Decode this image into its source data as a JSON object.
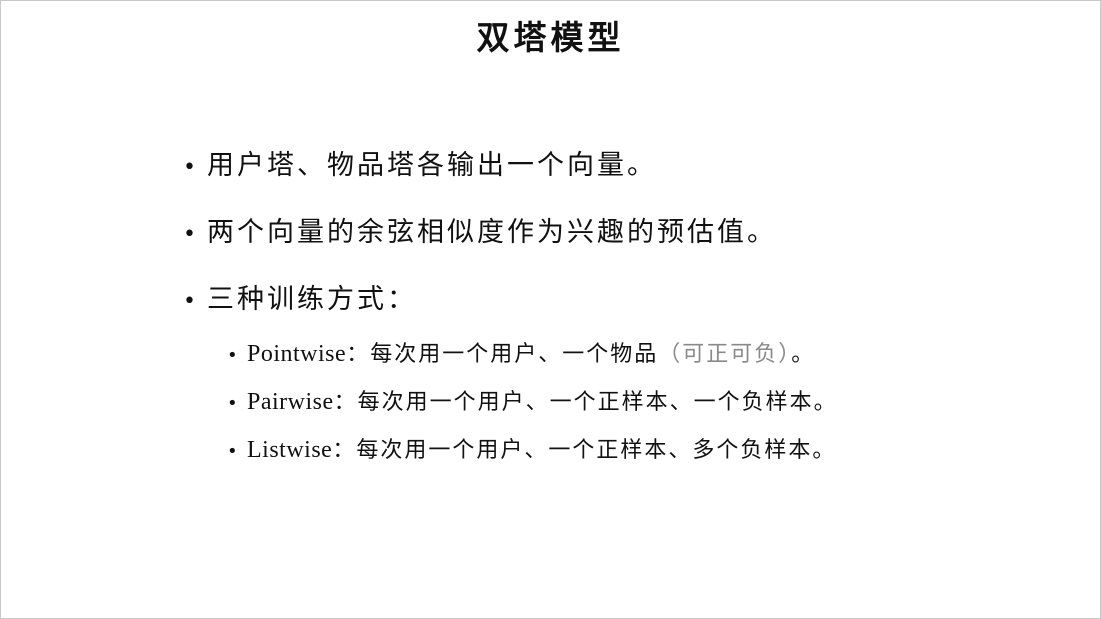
{
  "slide": {
    "title": "双塔模型",
    "bullets": [
      {
        "text": "用户塔、物品塔各输出一个向量。"
      },
      {
        "text": "两个向量的余弦相似度作为兴趣的预估值。"
      },
      {
        "text": "三种训练方式："
      }
    ],
    "sub_bullets": [
      {
        "term": "Pointwise",
        "sep": "：",
        "text": "每次用一个用户、一个物品",
        "note": "（可正可负）",
        "end": "。"
      },
      {
        "term": "Pairwise",
        "sep": "：",
        "text": "每次用一个用户、一个正样本、一个负样本。"
      },
      {
        "term": "Listwise",
        "sep": "：",
        "text": "每次用一个用户、一个正样本、多个负样本。"
      }
    ]
  }
}
